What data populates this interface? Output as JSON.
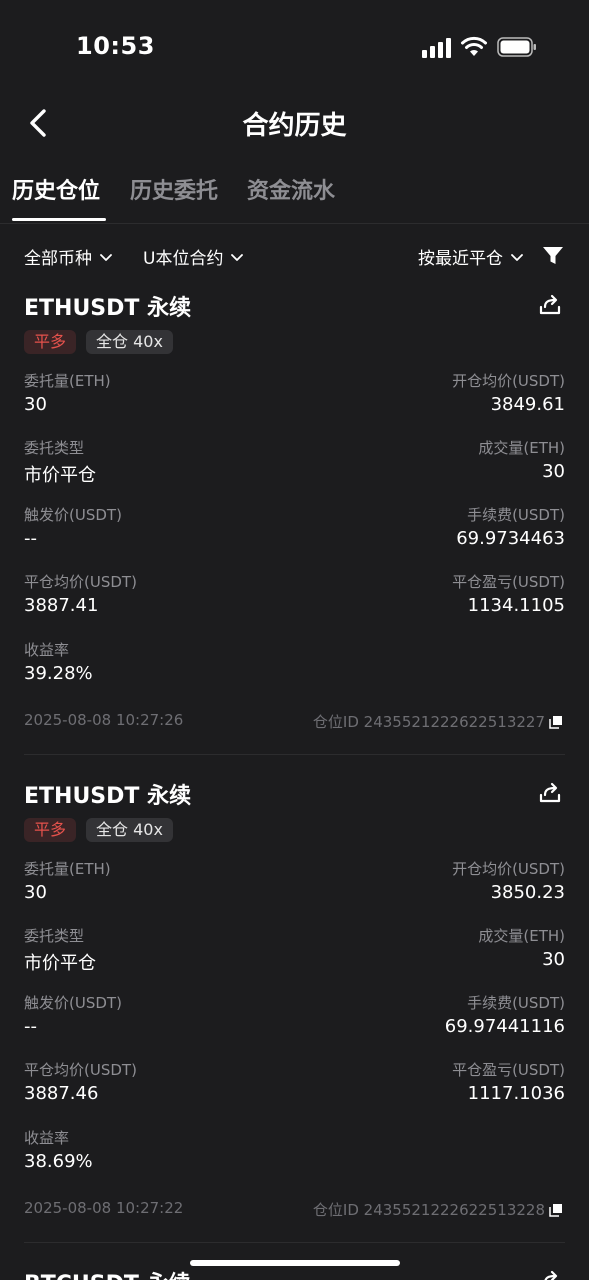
{
  "status_bar": {
    "time": "10:53"
  },
  "header": {
    "title": "合约历史"
  },
  "tabs": [
    {
      "label": "历史仓位",
      "active": true
    },
    {
      "label": "历史委托",
      "active": false
    },
    {
      "label": "资金流水",
      "active": false
    }
  ],
  "filters": {
    "coin": "全部币种",
    "contract": "U本位合约",
    "sort": "按最近平仓"
  },
  "labels": {
    "order_qty": "委托量(ETH)",
    "avg_open": "开仓均价(USDT)",
    "order_type": "委托类型",
    "filled_qty": "成交量(ETH)",
    "trigger_price": "触发价(USDT)",
    "fee": "手续费(USDT)",
    "avg_close": "平仓均价(USDT)",
    "pnl": "平仓盈亏(USDT)",
    "roi": "收益率"
  },
  "positions": [
    {
      "symbol": "ETHUSDT 永续",
      "side": "平多",
      "mode": "全仓 40x",
      "order_qty": "30",
      "avg_open": "3849.61",
      "order_type": "市价平仓",
      "filled_qty": "30",
      "trigger_price": "--",
      "fee": "69.9734463",
      "avg_close": "3887.41",
      "pnl": "1134.1105",
      "roi": "39.28%",
      "time": "2025-08-08 10:27:26",
      "position_id": "仓位ID 2435521222622513227"
    },
    {
      "symbol": "ETHUSDT 永续",
      "side": "平多",
      "mode": "全仓 40x",
      "order_qty": "30",
      "avg_open": "3850.23",
      "order_type": "市价平仓",
      "filled_qty": "30",
      "trigger_price": "--",
      "fee": "69.97441116",
      "avg_close": "3887.46",
      "pnl": "1117.1036",
      "roi": "38.69%",
      "time": "2025-08-08 10:27:22",
      "position_id": "仓位ID 2435521222622513228"
    },
    {
      "symbol": "BTCUSDT 永续"
    }
  ],
  "colors": {
    "background": "#1c1c1e",
    "loss_side_tag": "#e5524c",
    "muted_text": "#8e8e93"
  }
}
